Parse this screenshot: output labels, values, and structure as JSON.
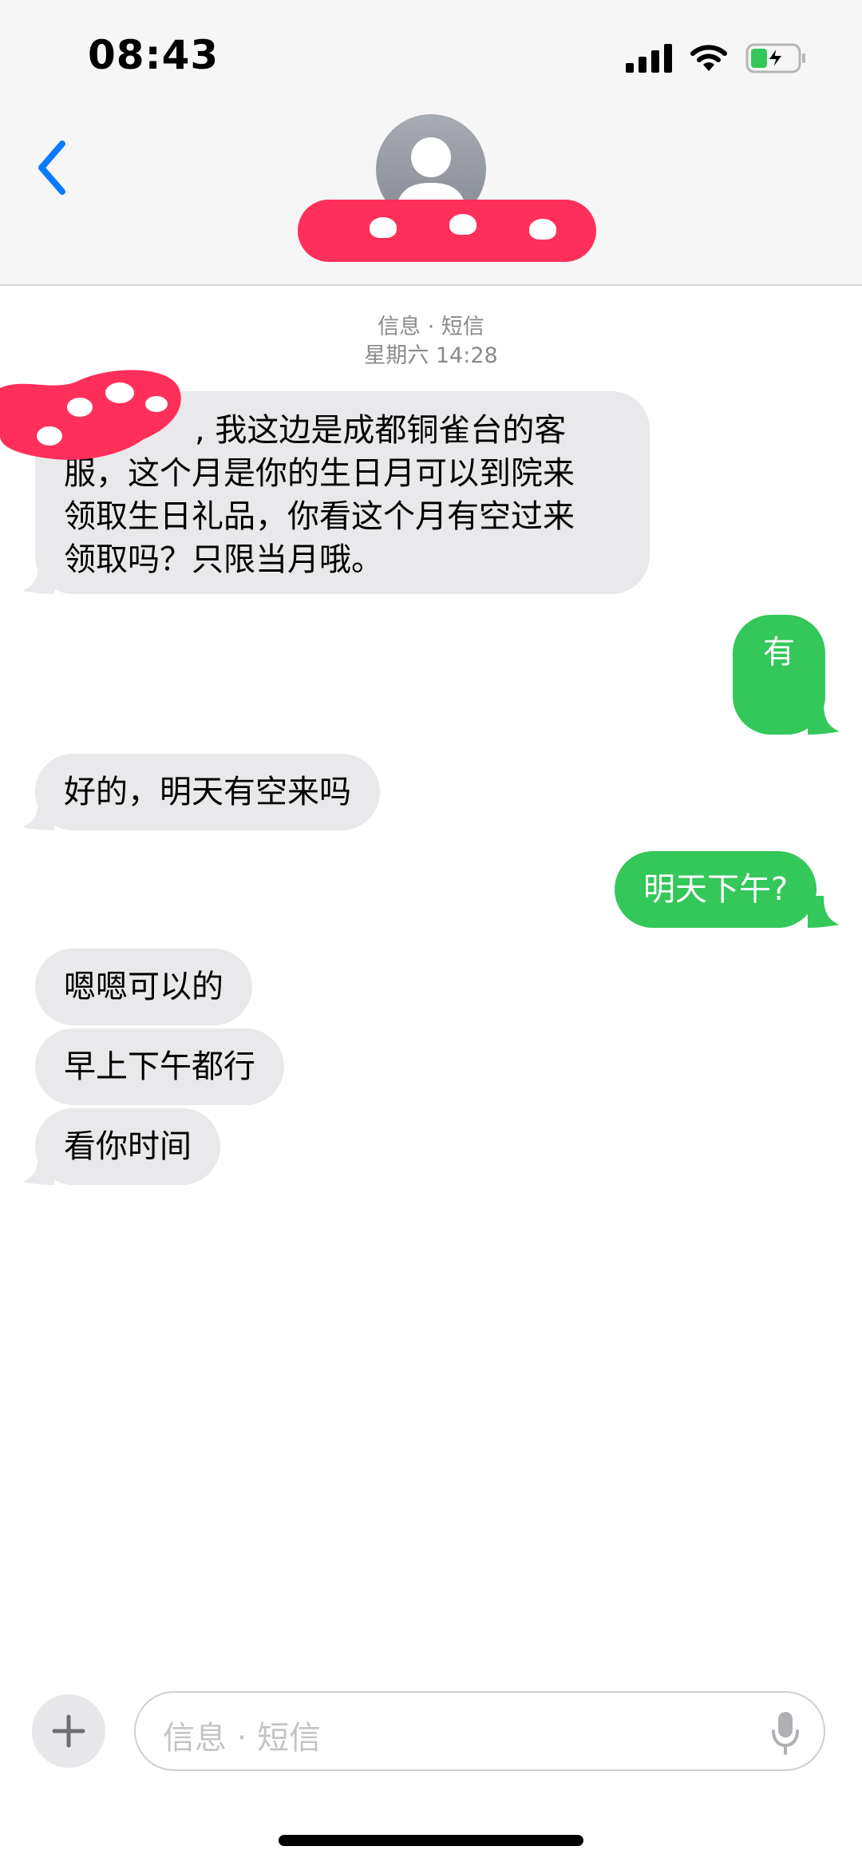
{
  "status_bar": {
    "time": "08:43"
  },
  "conversation": {
    "service_label": "信息 · 短信",
    "timestamp": "星期六 14:28",
    "messages": [
      {
        "from": "contact",
        "lines": [
          ", 我这边是成都铜雀台的客",
          "服，这个月是你的生日月可以到院来",
          "领取生日礼品，你看这个月有空过来",
          "领取吗？只限当月哦。"
        ]
      },
      {
        "from": "me",
        "text": "有"
      },
      {
        "from": "contact",
        "text": "好的，明天有空来吗"
      },
      {
        "from": "me",
        "text": "明天下午?"
      },
      {
        "from": "contact",
        "text": "嗯嗯可以的"
      },
      {
        "from": "contact",
        "text": "早上下午都行"
      },
      {
        "from": "contact",
        "text": "看你时间"
      }
    ]
  },
  "composer": {
    "placeholder": "信息 · 短信"
  },
  "colors": {
    "outgoing": "#34c759",
    "incoming": "#e9e9eb",
    "accent": "#0a7aff",
    "redaction": "#ff2f5b"
  },
  "icons": [
    "back-chevron-icon",
    "signal-icon",
    "wifi-icon",
    "battery-charging-icon",
    "plus-icon",
    "microphone-icon"
  ]
}
